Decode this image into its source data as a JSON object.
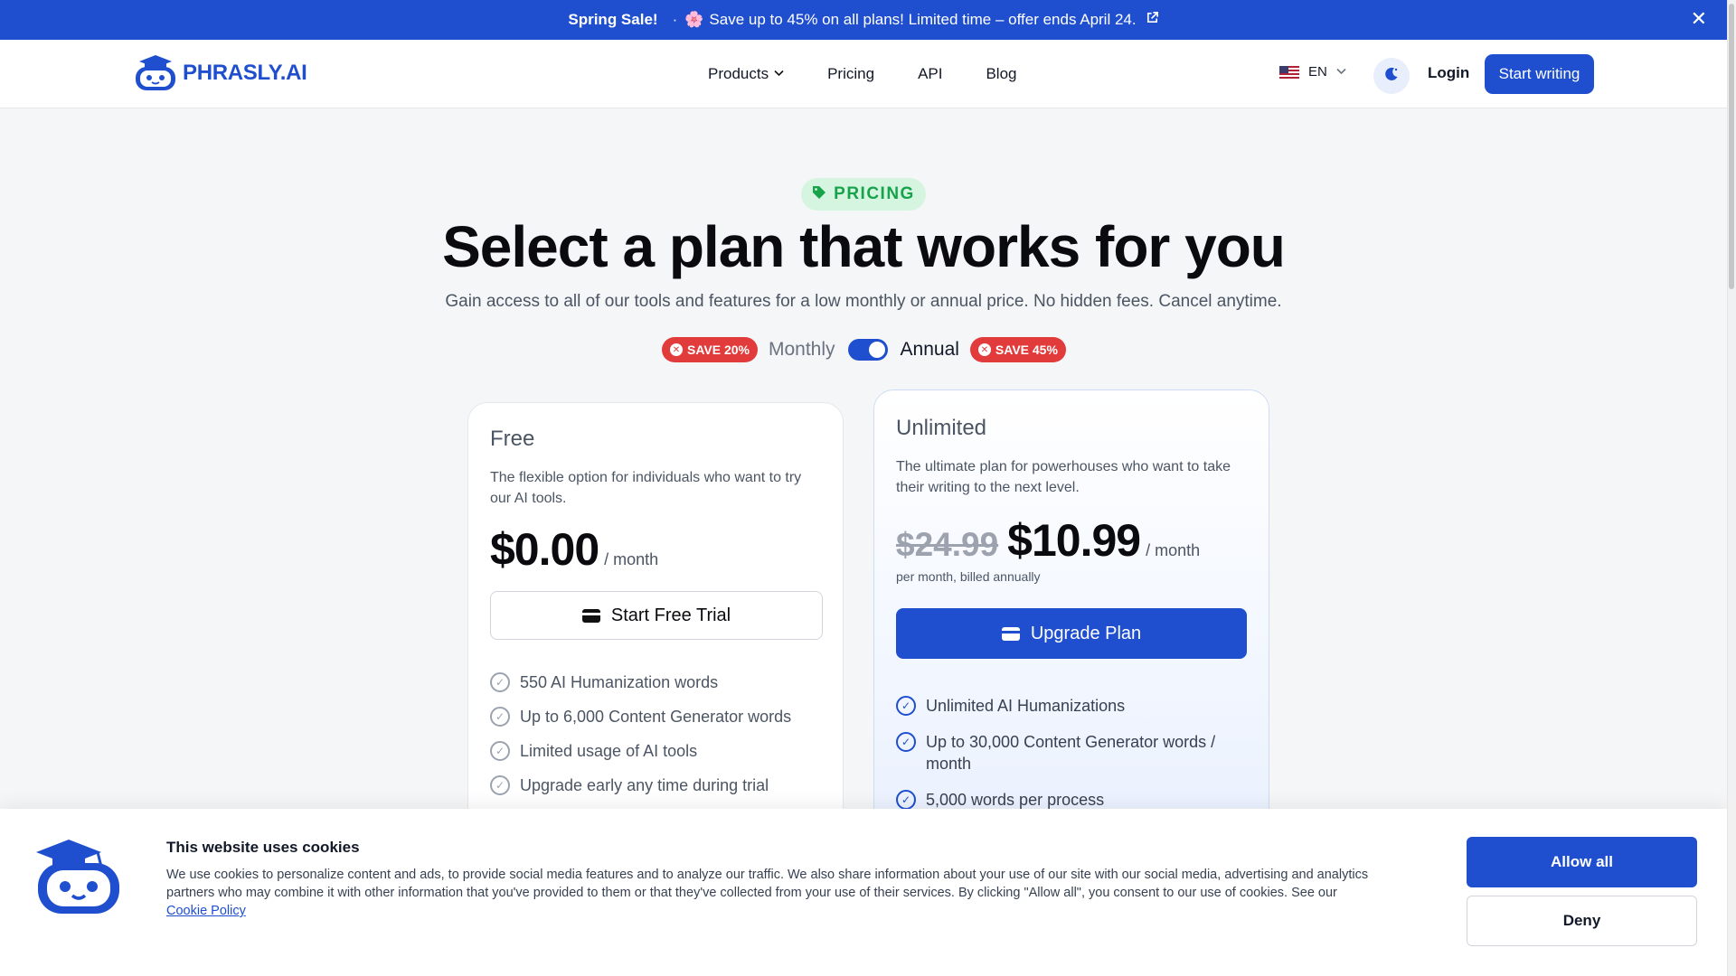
{
  "promo": {
    "sale_label": "Spring Sale!",
    "separator": "·",
    "flower_icon": "🌸",
    "message": "Save up to 45% on all plans! Limited time – offer ends April 24.",
    "external_icon": "external-link-icon",
    "close_glyph": "✕"
  },
  "nav": {
    "logo_text": "PHRASLY.AI",
    "items": [
      {
        "label": "Products",
        "has_dropdown": true
      },
      {
        "label": "Pricing"
      },
      {
        "label": "API"
      },
      {
        "label": "Blog"
      }
    ],
    "language": "EN",
    "login_label": "Login",
    "cta_label": "Start writing"
  },
  "hero": {
    "badge": "PRICING",
    "title": "Select a plan that works for you",
    "subtitle": "Gain access to all of our tools and features for a low monthly or annual price. No hidden fees. Cancel anytime.",
    "toggle": {
      "save_monthly": "SAVE 20%",
      "monthly_label": "Monthly",
      "annual_label": "Annual",
      "save_annual": "SAVE 45%",
      "selected": "Annual"
    }
  },
  "plans": {
    "free": {
      "name": "Free",
      "description": "The flexible option for individuals who want to try our AI tools.",
      "price": "$0.00",
      "period": "/ month",
      "button": "Start Free Trial",
      "features": [
        "550 AI Humanization words",
        "Up to 6,000 Content Generator words",
        "Limited usage of AI tools",
        "Upgrade early any time during trial"
      ]
    },
    "unlimited": {
      "name": "Unlimited",
      "description": "The ultimate plan for powerhouses who want to take their writing to the next level.",
      "old_price": "$24.99",
      "price": "$10.99",
      "period": "/ month",
      "billing_note": "per month, billed annually",
      "button": "Upgrade Plan",
      "features": [
        "Unlimited AI Humanizations",
        "Up to 30,000 Content Generator words / month",
        "5,000 words per process"
      ]
    }
  },
  "cookie": {
    "title": "This website uses cookies",
    "text": "We use cookies to personalize content and ads, to provide social media features and to analyze our traffic. We also share information about your use of our site with our social media, advertising and analytics partners who may combine it with other information that you've provided to them or that they've collected from your use of their services. By clicking \"Allow all\", you consent to our use of cookies. See our",
    "policy_link": "Cookie Policy",
    "allow_label": "Allow all",
    "deny_label": "Deny"
  },
  "colors": {
    "brand_blue": "#1f4fcf",
    "save_red": "#e23b3b",
    "pricing_green": "#16a34a"
  }
}
